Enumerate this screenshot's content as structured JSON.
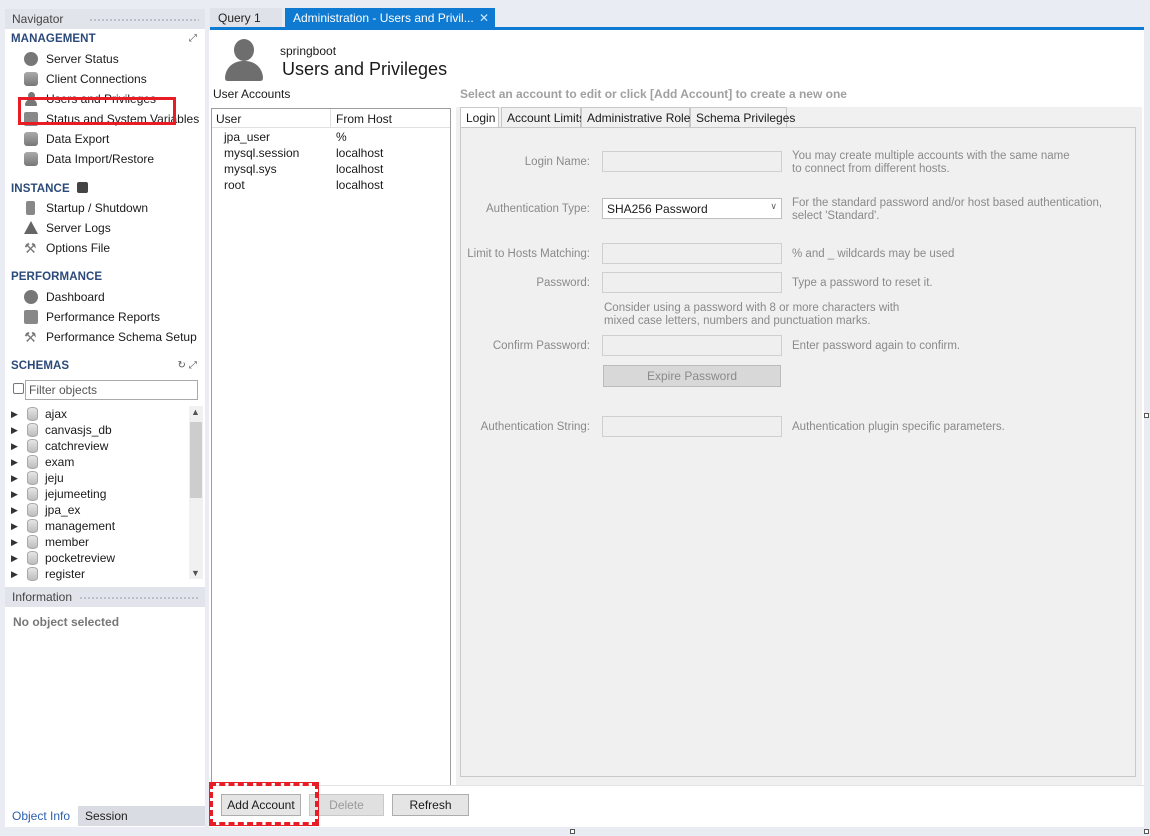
{
  "navigator": {
    "title": "Navigator",
    "management": {
      "title": "MANAGEMENT",
      "items": [
        {
          "label": "Server Status",
          "icon": "play-circle-icon"
        },
        {
          "label": "Client Connections",
          "icon": "database-icon"
        },
        {
          "label": "Users and Privileges",
          "icon": "user-icon"
        },
        {
          "label": "Status and System Variables",
          "icon": "variables-icon"
        },
        {
          "label": "Data Export",
          "icon": "export-icon"
        },
        {
          "label": "Data Import/Restore",
          "icon": "import-icon"
        }
      ]
    },
    "instance": {
      "title": "INSTANCE",
      "items": [
        {
          "label": "Startup / Shutdown",
          "icon": "power-icon"
        },
        {
          "label": "Server Logs",
          "icon": "warning-icon"
        },
        {
          "label": "Options File",
          "icon": "wrench-icon"
        }
      ]
    },
    "performance": {
      "title": "PERFORMANCE",
      "items": [
        {
          "label": "Dashboard",
          "icon": "dashboard-icon"
        },
        {
          "label": "Performance Reports",
          "icon": "reports-icon"
        },
        {
          "label": "Performance Schema Setup",
          "icon": "setup-icon"
        }
      ]
    },
    "schemas": {
      "title": "SCHEMAS",
      "filter_placeholder": "Filter objects",
      "items": [
        "ajax",
        "canvasjs_db",
        "catchreview",
        "exam",
        "jeju",
        "jejumeeting",
        "jpa_ex",
        "management",
        "member",
        "pocketreview",
        "register"
      ]
    },
    "information": {
      "title": "Information",
      "empty_text": "No object selected"
    },
    "bottom_tabs": [
      "Object Info",
      "Session"
    ]
  },
  "doc_tabs": {
    "query": "Query 1",
    "admin": "Administration - Users and Privil..."
  },
  "header": {
    "subtitle": "springboot",
    "title": "Users and Privileges"
  },
  "accounts": {
    "label": "User Accounts",
    "columns": [
      "User",
      "From Host"
    ],
    "rows": [
      [
        "jpa_user",
        "%"
      ],
      [
        "mysql.session",
        "localhost"
      ],
      [
        "mysql.sys",
        "localhost"
      ],
      [
        "root",
        "localhost"
      ]
    ]
  },
  "detail": {
    "hint": "Select an account to edit or click [Add Account] to create a new one",
    "tabs": [
      "Login",
      "Account Limits",
      "Administrative Roles",
      "Schema Privileges"
    ],
    "login": {
      "login_name_label": "Login Name:",
      "login_name_help": "You may create multiple accounts with the same name\nto connect from different hosts.",
      "auth_type_label": "Authentication Type:",
      "auth_type_value": "SHA256 Password",
      "auth_type_help": "For the standard password and/or host based authentication,\nselect 'Standard'.",
      "hosts_label": "Limit to Hosts Matching:",
      "hosts_help": "% and _ wildcards may be used",
      "password_label": "Password:",
      "password_help": "Type a password to reset it.",
      "password_note": "Consider using a password with 8 or more characters with\nmixed case letters, numbers and punctuation marks.",
      "confirm_label": "Confirm Password:",
      "confirm_help": "Enter password again to confirm.",
      "expire_button": "Expire Password",
      "auth_string_label": "Authentication String:",
      "auth_string_help": "Authentication plugin specific parameters."
    }
  },
  "buttons": {
    "add": "Add Account",
    "delete": "Delete",
    "refresh": "Refresh"
  },
  "colors": {
    "accent": "#0e7ad1",
    "highlight": "#e81c24"
  }
}
